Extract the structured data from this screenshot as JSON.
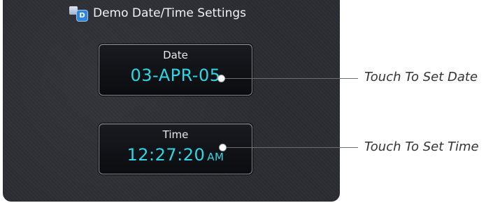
{
  "window": {
    "title": "Demo Date/Time Settings",
    "title_icon": "settings-badge-icon",
    "icon_letter": "D"
  },
  "buttons": {
    "date": {
      "label": "Date",
      "value": "03-APR-05"
    },
    "time": {
      "label": "Time",
      "value": "12:27:20",
      "meridiem": "AM"
    }
  },
  "callouts": {
    "date": "Touch To Set Date",
    "time": "Touch To Set Time"
  },
  "colors": {
    "value_cyan": "#2fd7e6",
    "panel_background": "#2d2e33",
    "button_border": "#8c8f96"
  }
}
